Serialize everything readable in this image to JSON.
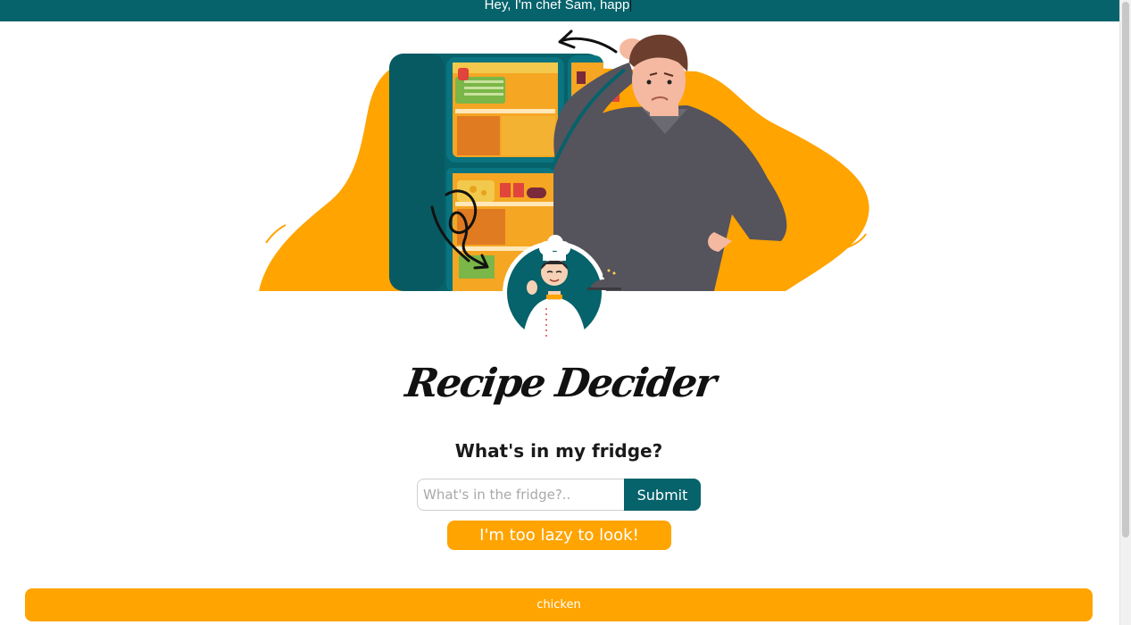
{
  "banner": {
    "text": "Hey, I'm chef Sam, happ"
  },
  "app": {
    "title": "Recipe Decider",
    "subtitle": "What's in my fridge?"
  },
  "search": {
    "value": "",
    "placeholder": "What's in the fridge?..",
    "submit_label": "Submit"
  },
  "lazy_button": {
    "label": "I'm too lazy to look!"
  },
  "results": [
    {
      "label": "chicken"
    }
  ],
  "colors": {
    "teal": "#06626b",
    "orange": "#ffa400",
    "dark_gray": "#55535c"
  },
  "icons": {
    "hero": "man-at-fridge-illustration",
    "avatar": "chef-avatar-icon"
  }
}
